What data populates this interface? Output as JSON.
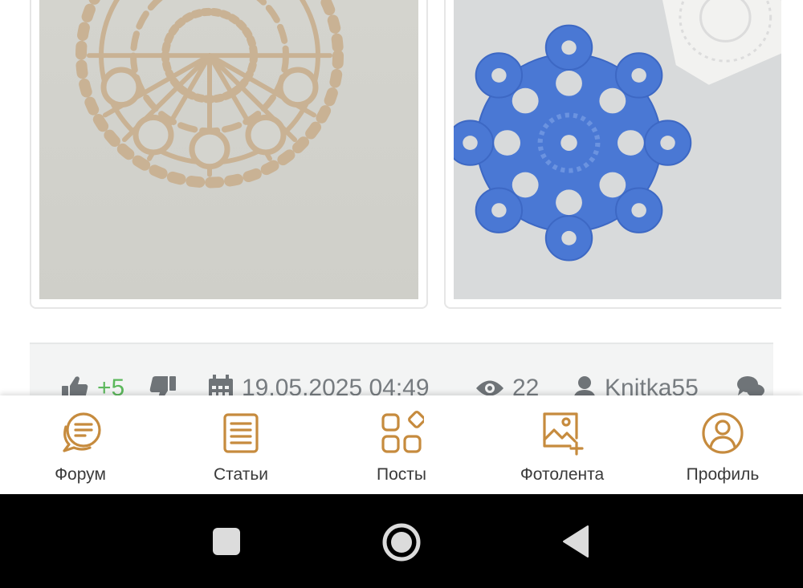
{
  "colors": {
    "accent": "#c68b3e",
    "like_green": "#5cb85c",
    "muted_text": "#777c80",
    "icon_gray": "#6f7478"
  },
  "photos": [
    {
      "description_icon": "beige-doily-photo"
    },
    {
      "description_icon": "blue-doily-photo"
    }
  ],
  "post_stats": {
    "likes": "+5",
    "date": "19.05.2025 04:49",
    "views": "22",
    "author": "Knitka55"
  },
  "bottom_nav": [
    {
      "label": "Форум",
      "icon": "forum-chat-icon"
    },
    {
      "label": "Статьи",
      "icon": "articles-icon"
    },
    {
      "label": "Посты",
      "icon": "posts-grid-icon"
    },
    {
      "label": "Фотолента",
      "icon": "photo-add-icon"
    },
    {
      "label": "Профиль",
      "icon": "profile-icon"
    }
  ],
  "system_nav": [
    "recents",
    "home",
    "back"
  ]
}
